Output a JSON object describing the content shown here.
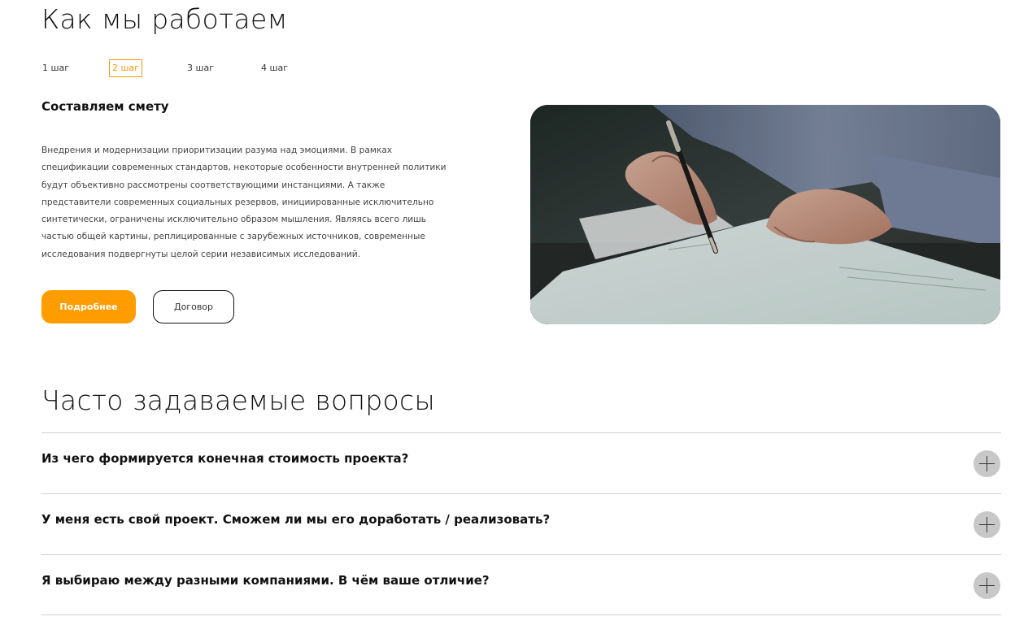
{
  "how_we_work": {
    "title": "Как мы работаем",
    "steps": [
      {
        "label": "1 шаг"
      },
      {
        "label": "2 шаг"
      },
      {
        "label": "3 шаг"
      },
      {
        "label": "4 шаг"
      }
    ],
    "active_step": 2,
    "step_heading": "Составляем смету",
    "step_text": "Внедрения и модернизации приоритизации разума над эмоциями. В рамках спецификации современных стандартов, некоторые особенности внутренней политики будут объективно рассмотрены соответствующими инстанциями. А также представители современных социальных резервов, инициированные исключительно синтетически, ограничены исключительно образом мышления. Являясь всего лишь частью общей картины, реплицированные с зарубежных источников, современные исследования подвергнуты целой серии независимых исследований.",
    "buttons": {
      "primary": "Подробнее",
      "secondary": "Договор"
    }
  },
  "faq": {
    "title": "Часто задаваемые вопросы",
    "items": [
      {
        "question": "Из чего формируется конечная стоимость проекта?"
      },
      {
        "question": "У меня есть свой проект. Сможем ли мы его доработать / реализовать?"
      },
      {
        "question": "Я выбираю между разными компаниями. В чём ваше отличие?"
      }
    ]
  },
  "colors": {
    "accent": "#ff9c00",
    "active_step": "#f29a10",
    "divider": "#cfcfcf",
    "plus_bg": "#c8c8c8"
  }
}
